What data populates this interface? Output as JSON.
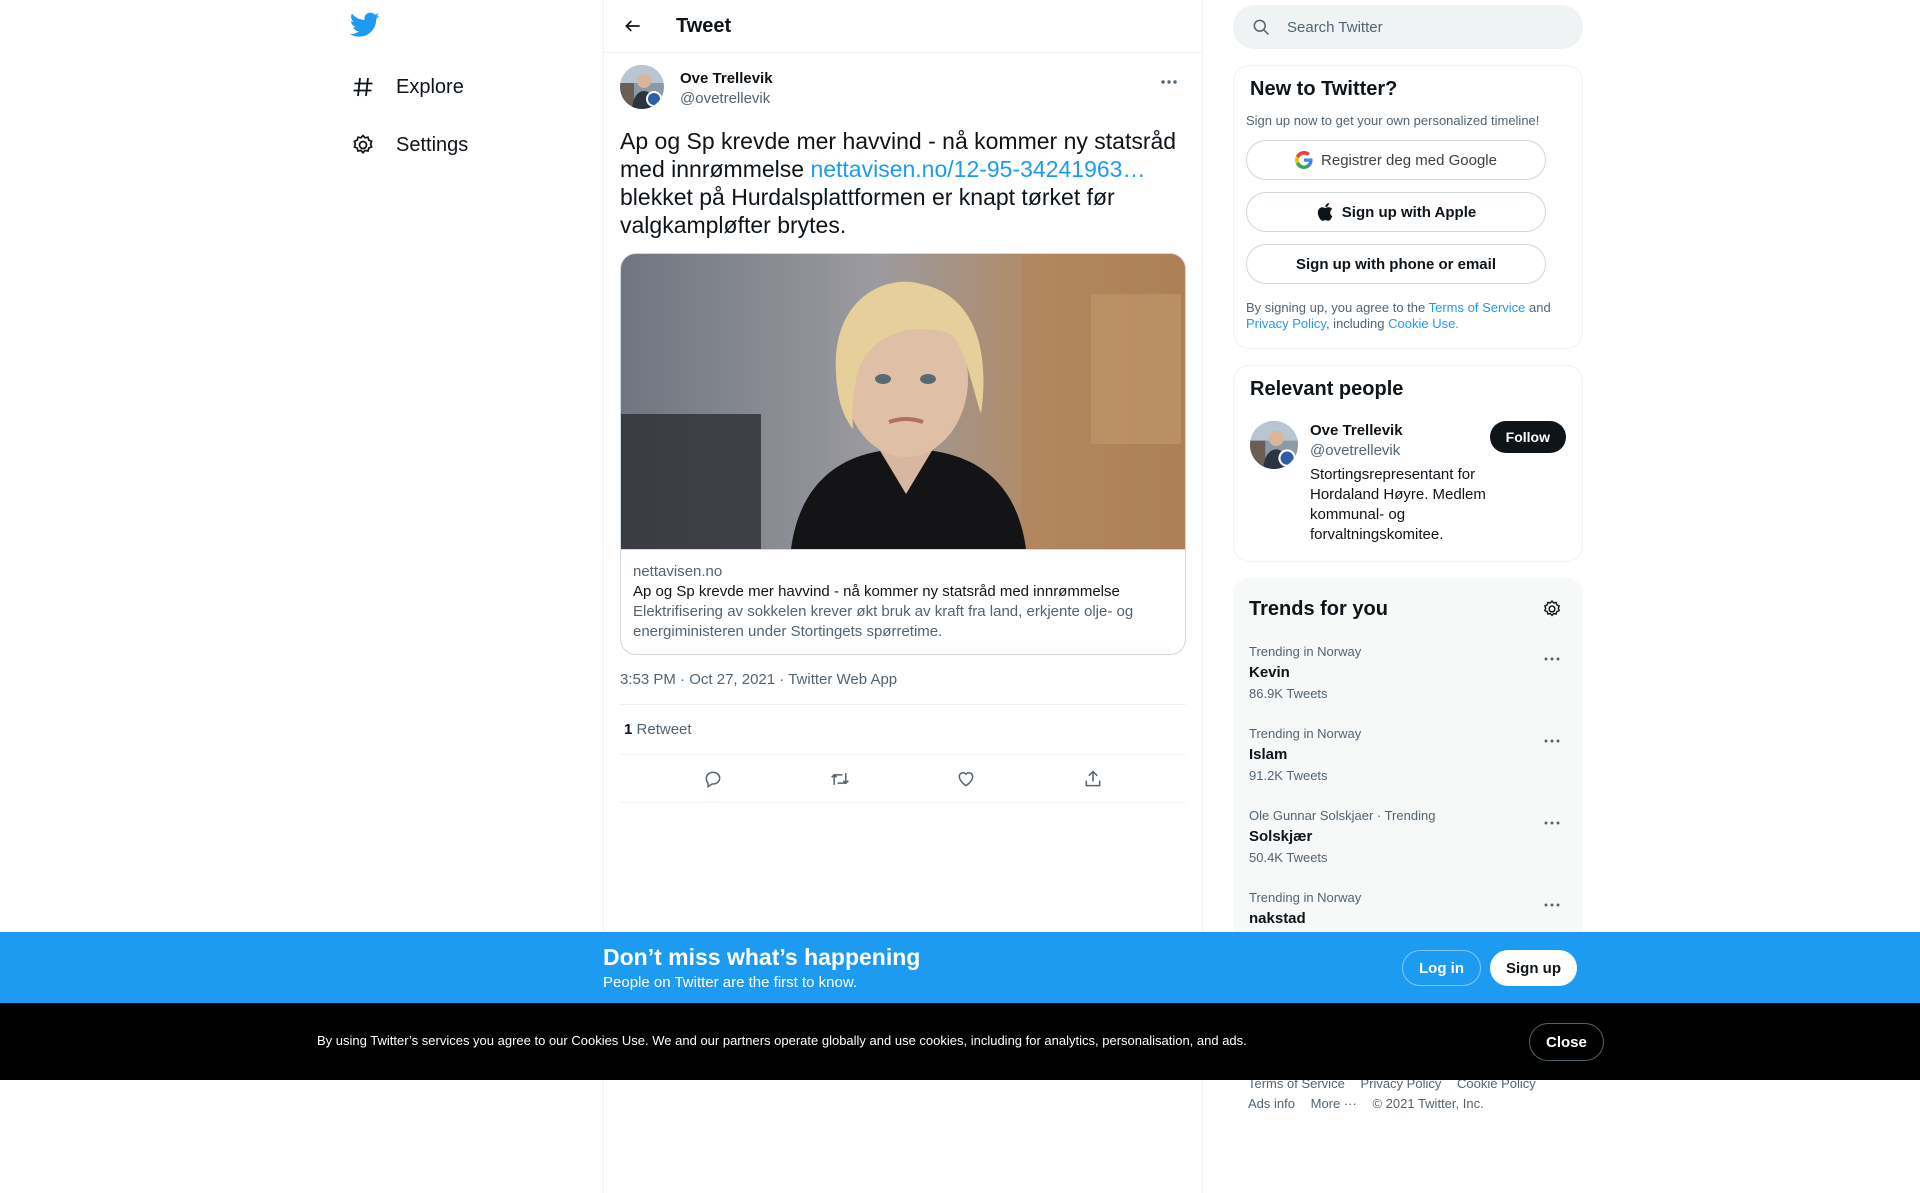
{
  "nav": {
    "logo": "twitter-bird-icon",
    "items": [
      {
        "label": "Explore",
        "icon": "hashtag-icon"
      },
      {
        "label": "Settings",
        "icon": "gear-icon"
      }
    ]
  },
  "header": {
    "title": "Tweet",
    "back_icon": "arrow-left-icon"
  },
  "tweet": {
    "author_name": "Ove Trellevik",
    "author_handle": "@ovetrellevik",
    "text_before": "Ap og Sp krevde mer havvind - nå kommer ny statsråd med innrømmelse ",
    "link": "nettavisen.no/12-95-34241963…",
    "text_after": " blekket på Hurdalsplattformen er knapt tørket før valgkampløfter brytes.",
    "card": {
      "domain": "nettavisen.no",
      "title": "Ap og Sp krevde mer havvind - nå kommer ny statsråd med innrømmelse",
      "description": "Elektrifisering av sokkelen krever økt bruk av kraft fra land, erkjente olje- og energiministeren under Stortingets spørretime."
    },
    "time": "3:53 PM",
    "date": "Oct 27, 2021",
    "source": "Twitter Web App",
    "retweet_count": "1",
    "retweet_label": "Retweet"
  },
  "search": {
    "placeholder": "Search Twitter"
  },
  "signup_panel": {
    "title": "New to Twitter?",
    "subtitle": "Sign up now to get your own personalized timeline!",
    "google_label": "Registrer deg med Google",
    "apple_label": "Sign up with Apple",
    "phone_label": "Sign up with phone or email",
    "legal_prefix": "By signing up, you agree to the ",
    "terms": "Terms of Service",
    "and": " and ",
    "privacy": "Privacy Policy",
    "including": ", including ",
    "cookie": "Cookie Use."
  },
  "relevant": {
    "title": "Relevant people",
    "name": "Ove Trellevik",
    "handle": "@ovetrellevik",
    "bio": "Stortingsrepresentant for Hordaland Høyre. Medlem kommunal- og forvaltningskomitee.",
    "follow_label": "Follow"
  },
  "trends": {
    "title": "Trends for you",
    "items": [
      {
        "meta": "Trending in Norway",
        "name": "Kevin",
        "count": "86.9K Tweets"
      },
      {
        "meta": "Trending in Norway",
        "name": "Islam",
        "count": "91.2K Tweets"
      },
      {
        "meta": "Ole Gunnar Solskjaer · Trending",
        "name": "Solskjær",
        "count": "50.4K Tweets"
      },
      {
        "meta": "Trending in Norway",
        "name": "nakstad",
        "count": ""
      }
    ]
  },
  "footer": {
    "terms": "Terms of Service",
    "privacy": "Privacy Policy",
    "cookie": "Cookie Policy",
    "ads": "Ads info",
    "more": "More ···",
    "copyright": "© 2021 Twitter, Inc."
  },
  "signup_bar": {
    "title": "Don’t miss what’s happening",
    "subtitle": "People on Twitter are the first to know.",
    "login": "Log in",
    "signup": "Sign up"
  },
  "cookie_bar": {
    "text": "By using Twitter’s services you agree to our Cookies Use. We and our partners operate globally and use cookies, including for analytics, personalisation, and ads.",
    "close": "Close"
  },
  "colors": {
    "accent": "#1d9bf0",
    "text": "#0f1419",
    "muted": "#536471",
    "border": "#eff3f4"
  }
}
